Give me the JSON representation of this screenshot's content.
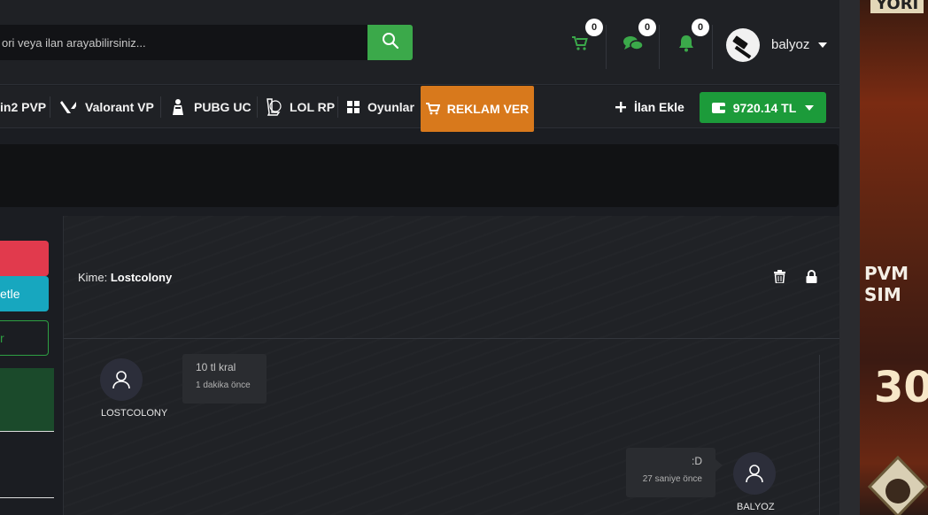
{
  "header": {
    "search_placeholder": "ori veya ilan arayabilirsiniz...",
    "cart_count": "0",
    "messages_count": "0",
    "notifications_count": "0",
    "username": "balyoz"
  },
  "nav": {
    "items": [
      "in2 PVP",
      "Valorant VP",
      "PUBG UC",
      "LOL RP",
      "Oyunlar"
    ],
    "ad_button": "REKLAM VER",
    "add_listing": "İlan Ekle",
    "balance": "9720.14 TL"
  },
  "sidebar": {
    "button2_label": "etle",
    "button3_label": "r"
  },
  "chat": {
    "to_label": "Kime:",
    "to_name": "Lostcolony",
    "messages": [
      {
        "user": "LOSTCOLONY",
        "text": "10 tl kral",
        "time": "1 dakika önce"
      },
      {
        "user": "BALYOZ",
        "text": ":D",
        "time": "27 saniye önce"
      }
    ]
  },
  "ad": {
    "top": "YORI",
    "mid": "PVM SIM",
    "num": "30"
  },
  "colors": {
    "accent_green": "#3ba94a",
    "ad_orange": "#d8791c",
    "balance_green": "#1c9b3a",
    "red": "#e13a4d",
    "teal": "#17a7bf"
  }
}
